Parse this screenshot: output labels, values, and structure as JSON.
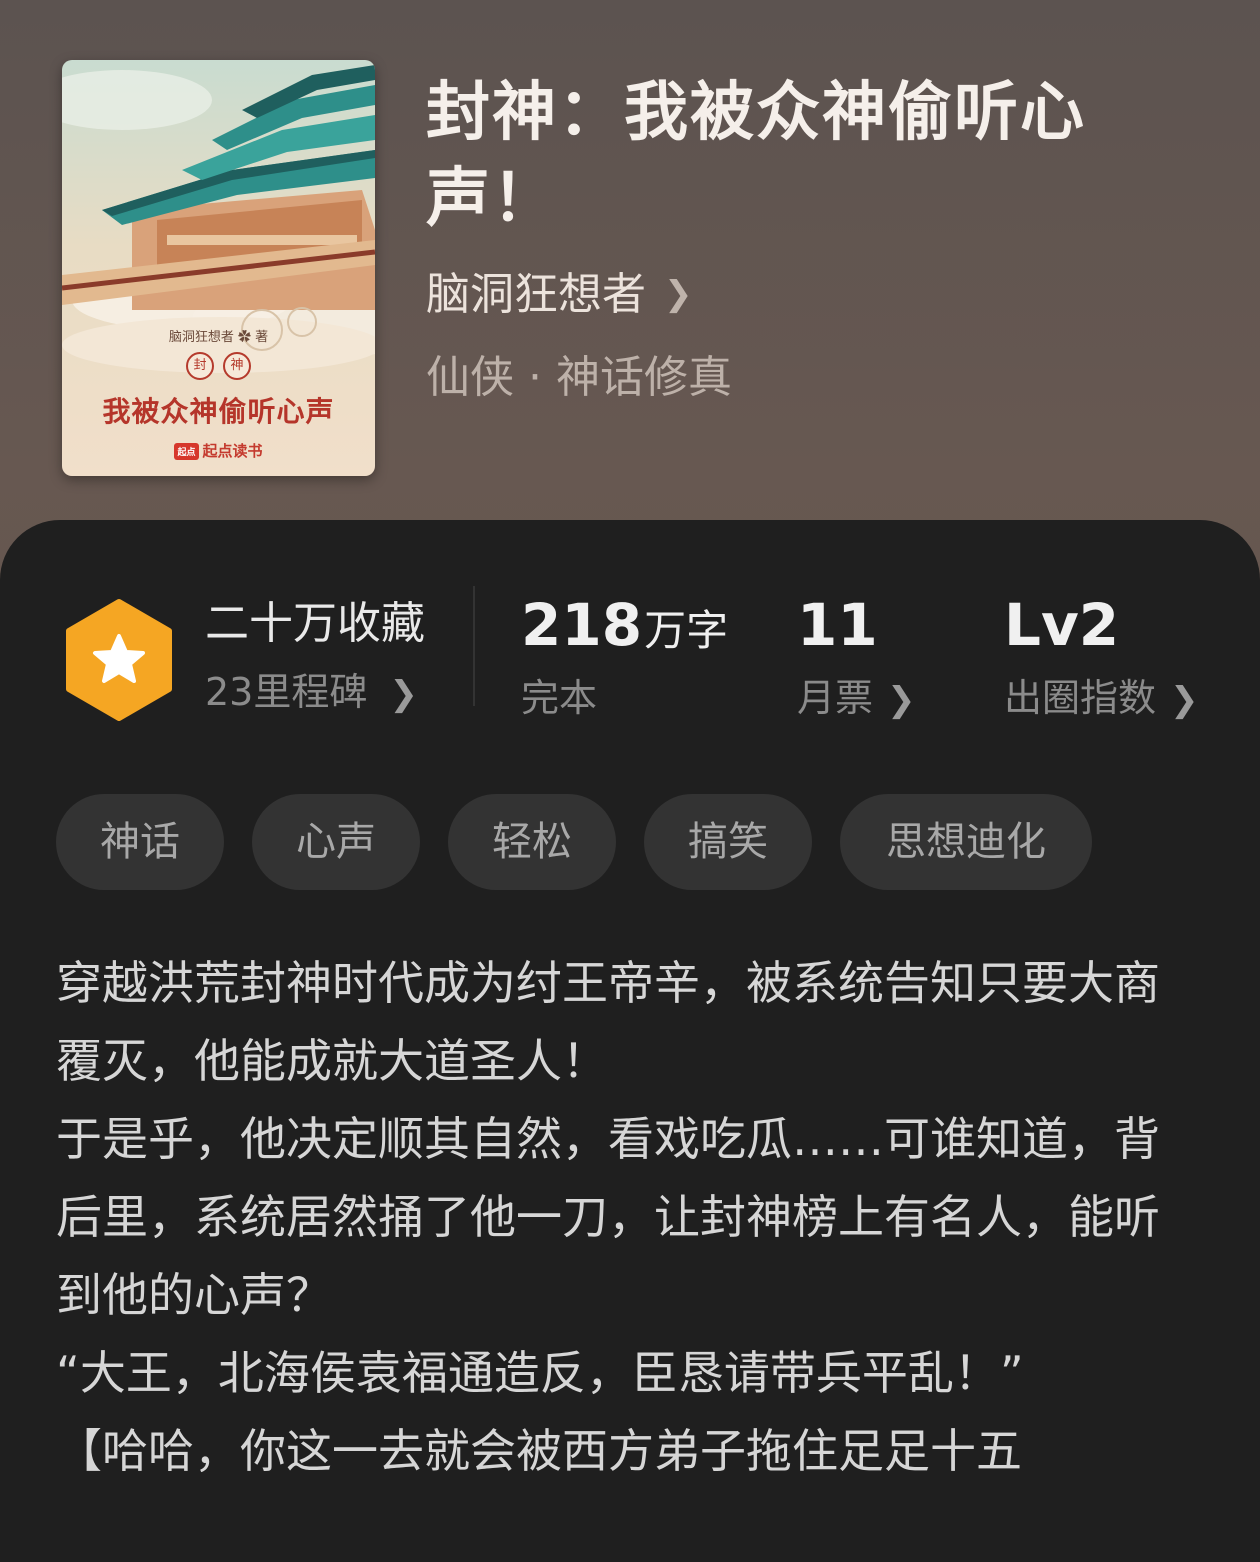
{
  "book": {
    "title": "封神：我被众神偷听心声！",
    "author": "脑洞狂想者",
    "genre": "仙侠 · 神话修真",
    "cover": {
      "author_line": "脑洞狂想者 ✿ 著",
      "seal_1": "封",
      "seal_2": "神",
      "title": "我被众神偷听心声",
      "publisher_logo": "起点",
      "publisher": "起点读书"
    }
  },
  "stats": {
    "favorites": {
      "label": "二十万收藏",
      "sub": "23里程碑",
      "icon": "star-hexagon-icon",
      "color": "#f5a623"
    },
    "words": {
      "value": "218",
      "unit": "万字",
      "sub": "完本"
    },
    "tickets": {
      "value": "11",
      "sub": "月票"
    },
    "index": {
      "value": "Lv2",
      "sub": "出圈指数"
    }
  },
  "tags": [
    "神话",
    "心声",
    "轻松",
    "搞笑",
    "思想迪化"
  ],
  "description": [
    "穿越洪荒封神时代成为纣王帝辛，被系统告知只要大商覆灭，他能成就大道圣人！",
    "于是乎，他决定顺其自然，看戏吃瓜……可谁知道，背后里，系统居然捅了他一刀，让封神榜上有名人，能听到他的心声？",
    "“大王，北海侯袁福通造反，臣恳请带兵平乱！”",
    "【哈哈，你这一去就会被西方弟子拖住足足十五"
  ]
}
